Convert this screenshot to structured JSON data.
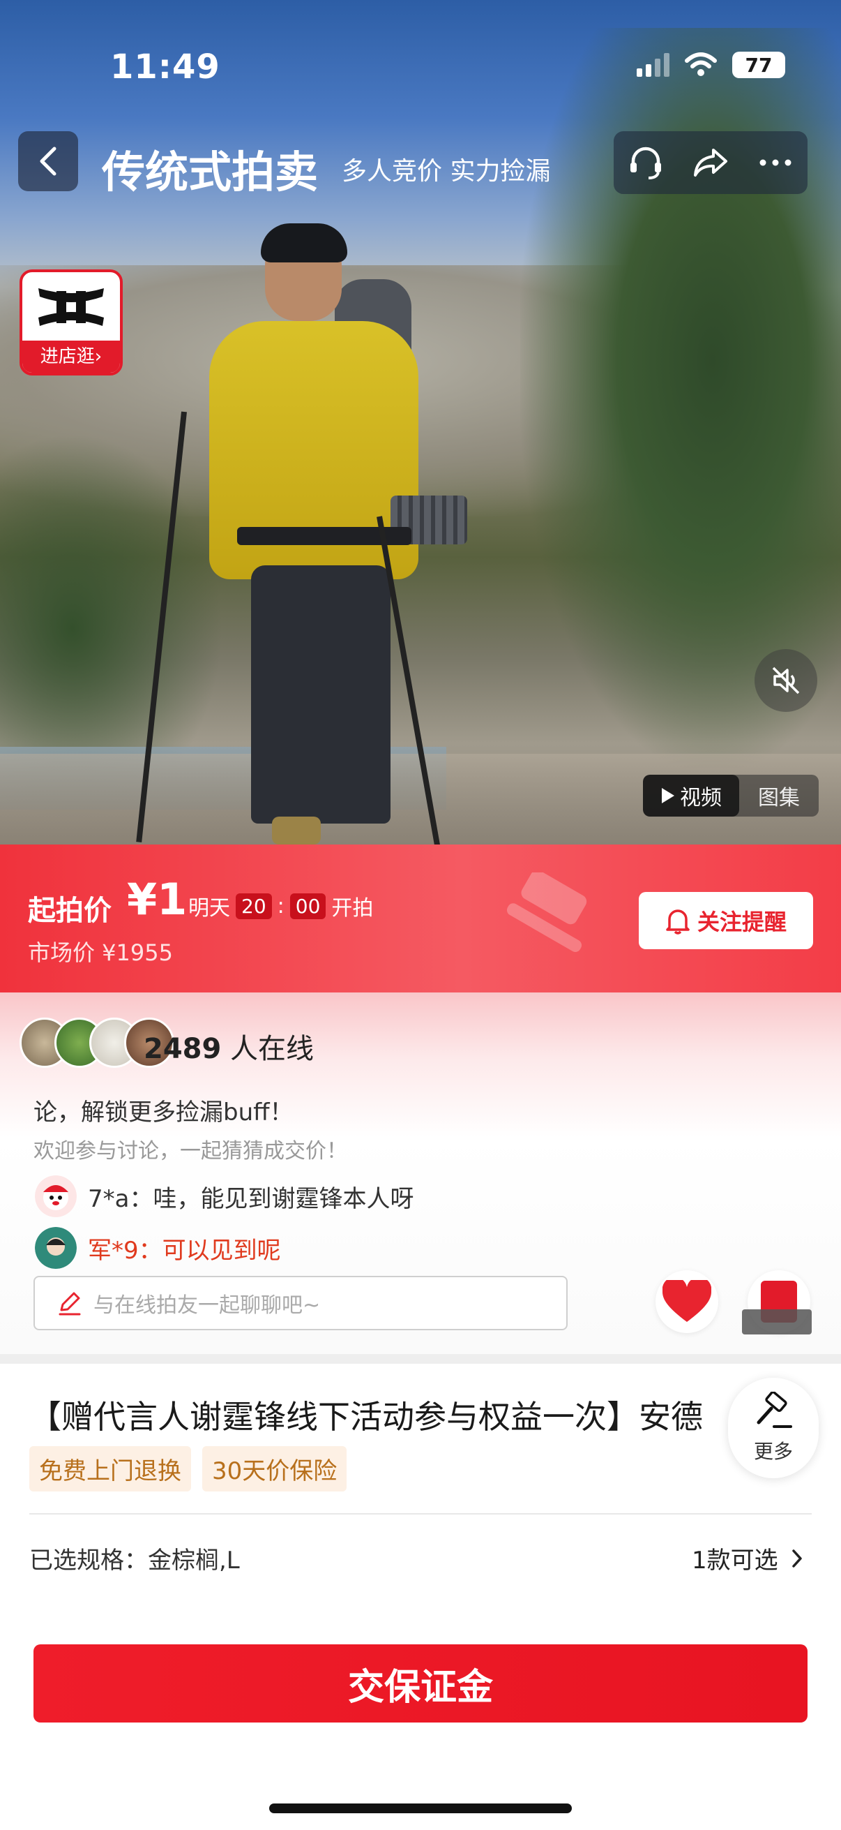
{
  "status_bar": {
    "time": "11:49",
    "battery": "77"
  },
  "nav": {
    "title": "传统式拍卖",
    "subtitle": "多人竞价  实力捡漏",
    "icons": [
      "back-icon",
      "headset-icon",
      "share-icon",
      "more-dots-icon"
    ]
  },
  "shop": {
    "enter_label": "进店逛›"
  },
  "media": {
    "video_label": "视频",
    "gallery_label": "图集"
  },
  "auction": {
    "start_label": "起拍价",
    "start_price": "¥1",
    "day": "明天",
    "hour": "20",
    "colon": ":",
    "minute": "00",
    "start_suffix": "开拍",
    "market_price": "市场价 ¥1955",
    "remind_label": "关注提醒"
  },
  "live": {
    "online_count": "2489",
    "online_label": "人在线",
    "pinned": "论，解锁更多捡漏buff！",
    "welcome": "欢迎参与讨论，一起猜猜成交价！",
    "messages": [
      {
        "text": "7*a：哇，能见到谢霆锋本人呀"
      },
      {
        "text": "军*9：可以见到呢"
      }
    ],
    "input_placeholder": "与在线拍友一起聊聊吧~"
  },
  "product": {
    "title": "【赠代言人谢霆锋线下活动参与权益一次】安德",
    "tags": [
      "免费上门退换",
      "30天价保险"
    ],
    "more_label": "更多",
    "spec_label": "已选规格：金棕榈,L",
    "spec_count": "1款可选"
  },
  "cta": {
    "deposit_label": "交保证金"
  },
  "colors": {
    "accent": "#E8242F",
    "tag_bg": "#FDF0E4",
    "tag_text": "#B8701C"
  }
}
